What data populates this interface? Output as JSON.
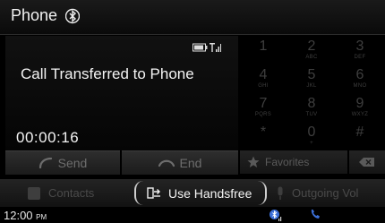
{
  "header": {
    "title": "Phone",
    "icon": "bluetooth-icon"
  },
  "call": {
    "status": "Call Transferred to Phone",
    "timer": "00:00:16",
    "signal_icon": "signal-battery-icon"
  },
  "call_buttons": {
    "send": "Send",
    "end": "End"
  },
  "keypad": [
    {
      "digit": "1",
      "letters": ""
    },
    {
      "digit": "2",
      "letters": "ABC"
    },
    {
      "digit": "3",
      "letters": "DEF"
    },
    {
      "digit": "4",
      "letters": "GHI"
    },
    {
      "digit": "5",
      "letters": "JKL"
    },
    {
      "digit": "6",
      "letters": "MNO"
    },
    {
      "digit": "7",
      "letters": "PQRS"
    },
    {
      "digit": "8",
      "letters": "TUV"
    },
    {
      "digit": "9",
      "letters": "WXYZ"
    },
    {
      "digit": "*",
      "letters": ""
    },
    {
      "digit": "0",
      "letters": "+"
    },
    {
      "digit": "#",
      "letters": ""
    }
  ],
  "favorites": {
    "label": "Favorites"
  },
  "bottom": {
    "contacts": "Contacts",
    "handsfree": "Use Handsfree",
    "outgoing": "Outgoing Vol"
  },
  "status": {
    "time": "12:00",
    "ampm": "PM"
  },
  "colors": {
    "active_text": "#f5f5f5",
    "dim_text": "#4a4a4a",
    "accent_blue": "#3b6fd8"
  }
}
